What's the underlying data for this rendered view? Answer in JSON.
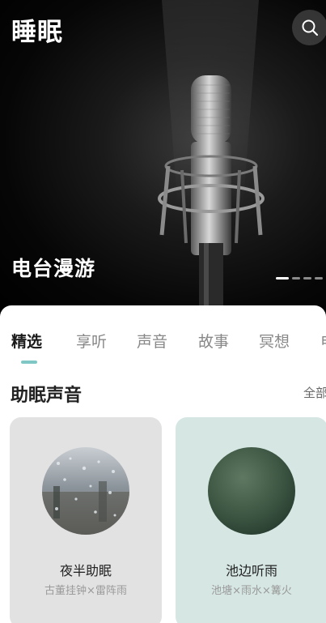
{
  "app": {
    "title": "睡眠"
  },
  "hero": {
    "caption": "电台漫游",
    "carousel": {
      "count": 4,
      "active_index": 0
    }
  },
  "icons": {
    "search": "search-icon",
    "hero_art": "microphone-illustration"
  },
  "tabs": [
    {
      "label": "精选",
      "active": true
    },
    {
      "label": "享听",
      "active": false
    },
    {
      "label": "声音",
      "active": false
    },
    {
      "label": "故事",
      "active": false
    },
    {
      "label": "冥想",
      "active": false
    },
    {
      "label": "电",
      "active": false
    }
  ],
  "section": {
    "title": "助眠声音",
    "see_all": "全部"
  },
  "cards": [
    {
      "title": "夜半助眠",
      "subtitle": "古董挂钟×雷阵雨",
      "background": "#e2e2e2"
    },
    {
      "title": "池边听雨",
      "subtitle": "池塘×雨水×篝火",
      "background": "#d5e6e3"
    }
  ],
  "colors": {
    "accent": "#7fc7c4",
    "hero_bg": "#000000"
  }
}
